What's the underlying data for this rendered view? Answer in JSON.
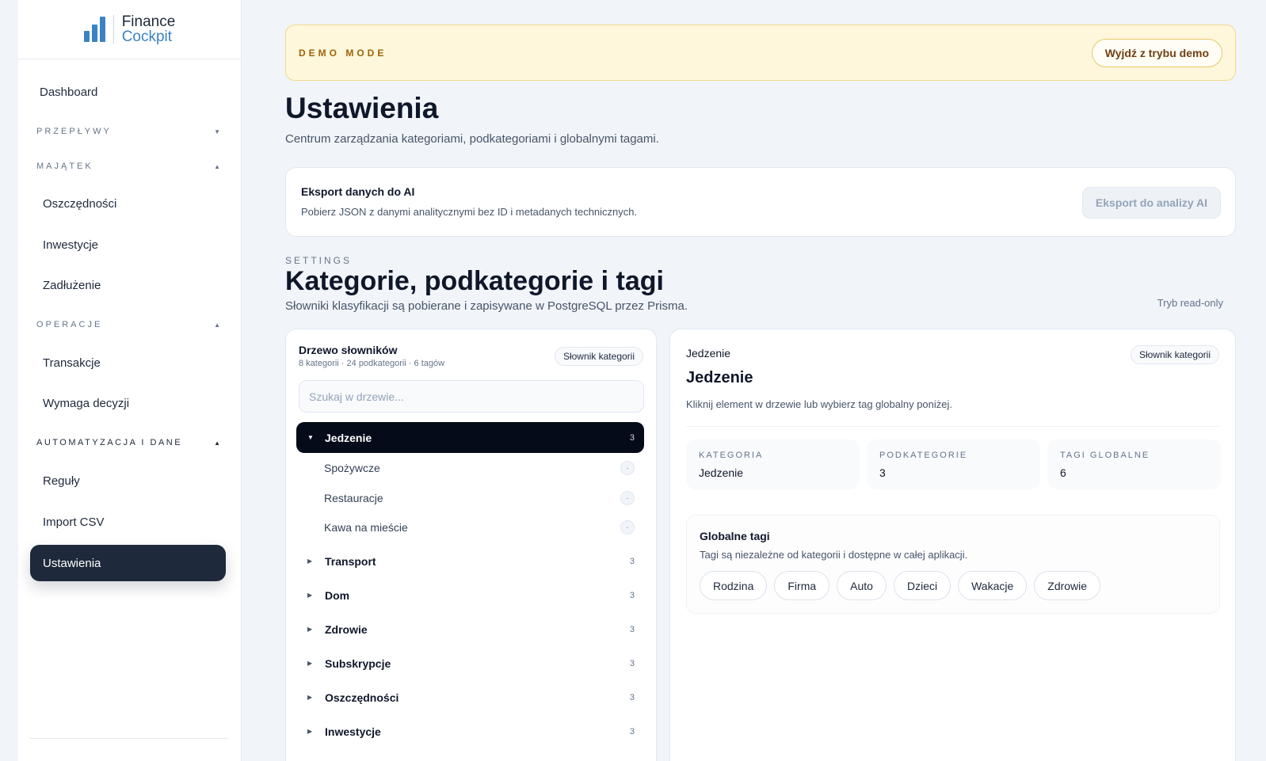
{
  "brand": {
    "line1": "Finance",
    "line2": "Cockpit"
  },
  "nav": {
    "dashboard": "Dashboard",
    "sections": {
      "przeplywy": "PRZEPŁYWY",
      "majatek": "MAJĄTEK",
      "operacje": "OPERACJE",
      "automatyzacja": "AUTOMATYZACJA I DANE"
    },
    "items": {
      "oszczednosci": "Oszczędności",
      "inwestycje": "Inwestycje",
      "zadluzenie": "Zadłużenie",
      "transakcje": "Transakcje",
      "wymaga": "Wymaga decyzji",
      "reguly": "Reguły",
      "import": "Import CSV",
      "ustawienia": "Ustawienia"
    }
  },
  "demo": {
    "label": "DEMO MODE",
    "exit_button": "Wyjdź z trybu demo"
  },
  "page": {
    "title": "Ustawienia",
    "subtitle": "Centrum zarządzania kategoriami, podkategoriami i globalnymi tagami."
  },
  "export": {
    "title": "Eksport danych do AI",
    "description": "Pobierz JSON z danymi analitycznymi bez ID i metadanych technicznych.",
    "button": "Eksport do analizy AI"
  },
  "settings": {
    "eyebrow": "SETTINGS",
    "title": "Kategorie, podkategorie i tagi",
    "subtitle": "Słowniki klasyfikacji są pobierane i zapisywane w PostgreSQL przez Prisma.",
    "mode": "Tryb read-only"
  },
  "tree": {
    "title": "Drzewo słowników",
    "meta": "8 kategorii · 24 podkategorii · 6 tagów",
    "badge": "Słownik kategorii",
    "search_placeholder": "Szukaj w drzewie...",
    "categories": [
      {
        "name": "Jedzenie",
        "count": "3"
      },
      {
        "name": "Transport",
        "count": "3"
      },
      {
        "name": "Dom",
        "count": "3"
      },
      {
        "name": "Zdrowie",
        "count": "3"
      },
      {
        "name": "Subskrypcje",
        "count": "3"
      },
      {
        "name": "Oszczędności",
        "count": "3"
      },
      {
        "name": "Inwestycje",
        "count": "3"
      }
    ],
    "subcategories": [
      {
        "name": "Spożywcze",
        "mark": "·"
      },
      {
        "name": "Restauracje",
        "mark": "·"
      },
      {
        "name": "Kawa na mieście",
        "mark": "·"
      }
    ]
  },
  "detail": {
    "eyebrow": "Jedzenie",
    "badge": "Słownik kategorii",
    "title": "Jedzenie",
    "description": "Kliknij element w drzewie lub wybierz tag globalny poniżej.",
    "stats": [
      {
        "label": "KATEGORIA",
        "value": "Jedzenie"
      },
      {
        "label": "PODKATEGORIE",
        "value": "3"
      },
      {
        "label": "TAGI GLOBALNE",
        "value": "6"
      }
    ],
    "tags_title": "Globalne tagi",
    "tags_desc": "Tagi są niezależne od kategorii i dostępne w całej aplikacji.",
    "tags": [
      "Rodzina",
      "Firma",
      "Auto",
      "Dzieci",
      "Wakacje",
      "Zdrowie"
    ]
  },
  "colors": {
    "accent": "#3b82c4",
    "active_nav": "#1e293b",
    "active_tree": "#060b1a",
    "demo_bg": "#fef7dc"
  }
}
